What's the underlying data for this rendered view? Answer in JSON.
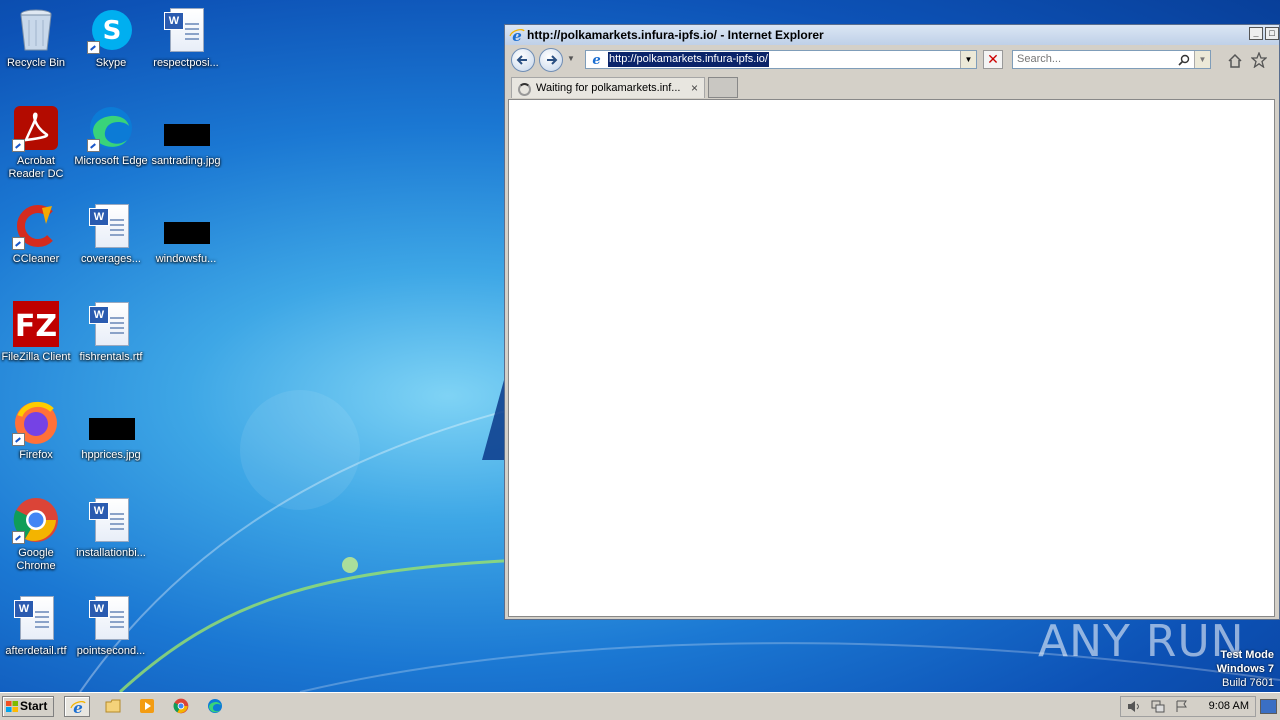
{
  "desktop": {
    "icons": [
      {
        "label": "Recycle Bin",
        "icon": "recycle-bin-icon"
      },
      {
        "label": "Skype",
        "icon": "skype-icon"
      },
      {
        "label": "respectposi...",
        "icon": "word-document-icon"
      },
      {
        "label": "Acrobat Reader DC",
        "icon": "acrobat-icon"
      },
      {
        "label": "Microsoft Edge",
        "icon": "edge-icon"
      },
      {
        "label": "santrading.jpg",
        "icon": "image-file-icon"
      },
      {
        "label": "CCleaner",
        "icon": "ccleaner-icon"
      },
      {
        "label": "coverages...",
        "icon": "word-document-icon"
      },
      {
        "label": "windowsfu...",
        "icon": "image-file-icon"
      },
      {
        "label": "FileZilla Client",
        "icon": "filezilla-icon"
      },
      {
        "label": "fishrentals.rtf",
        "icon": "word-document-icon"
      },
      {
        "label": "Firefox",
        "icon": "firefox-icon"
      },
      {
        "label": "hpprices.jpg",
        "icon": "image-file-icon"
      },
      {
        "label": "Google Chrome",
        "icon": "chrome-icon"
      },
      {
        "label": "installationbi...",
        "icon": "word-document-icon"
      },
      {
        "label": "afterdetail.rtf",
        "icon": "word-document-icon"
      },
      {
        "label": "pointsecond...",
        "icon": "word-document-icon"
      }
    ]
  },
  "browser": {
    "title": "http://polkamarkets.infura-ipfs.io/ - Internet Explorer",
    "address": "http://polkamarkets.infura-ipfs.io/",
    "search_placeholder": "Search...",
    "tab_label": "Waiting for polkamarkets.inf...",
    "tab_close": "×"
  },
  "watermark": "ANY RUN",
  "os_info": {
    "line1": "Test Mode",
    "line2": "Windows 7",
    "line3": "Build 7601"
  },
  "taskbar": {
    "start_label": "Start",
    "clock": "9:08 AM",
    "pinned": [
      "internet-explorer-icon",
      "explorer-folder-icon",
      "media-player-icon",
      "chrome-icon",
      "edge-icon"
    ]
  },
  "colors": {
    "desktop_blue": "#1b78d3",
    "selection": "#0a246a",
    "taskbar": "#d4d0c8"
  }
}
